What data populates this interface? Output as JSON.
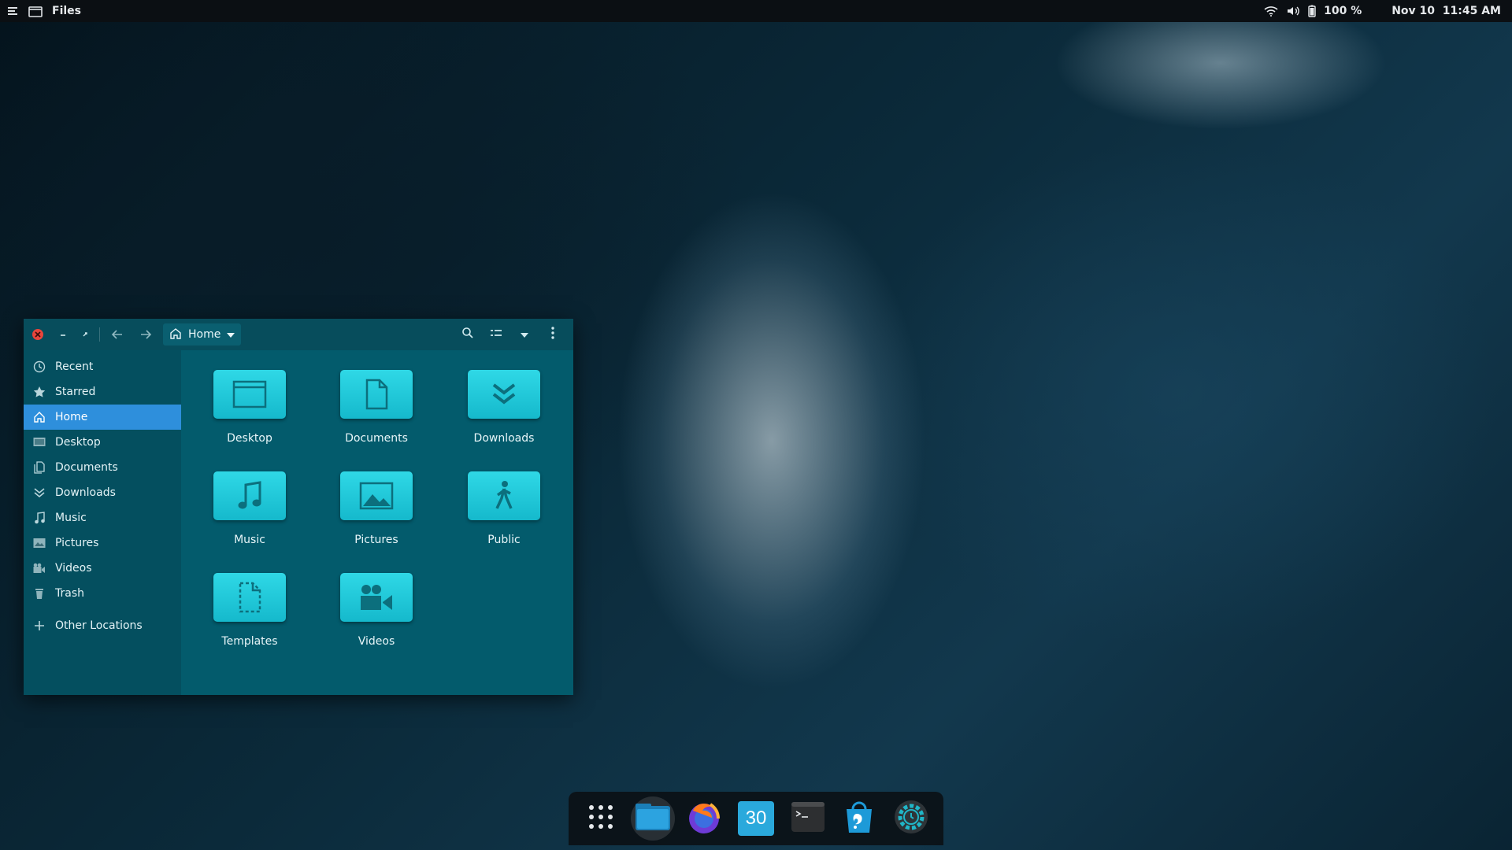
{
  "topbar": {
    "app_name": "Files",
    "battery": "100 %",
    "datetime": "Nov 10  11:45 AM"
  },
  "window": {
    "location": "Home"
  },
  "sidebar": {
    "items": [
      {
        "label": "Recent",
        "icon": "clock-icon"
      },
      {
        "label": "Starred",
        "icon": "star-icon"
      },
      {
        "label": "Home",
        "icon": "home-icon",
        "active": true
      },
      {
        "label": "Desktop",
        "icon": "desktop-icon"
      },
      {
        "label": "Documents",
        "icon": "document-icon"
      },
      {
        "label": "Downloads",
        "icon": "download-icon"
      },
      {
        "label": "Music",
        "icon": "music-icon"
      },
      {
        "label": "Pictures",
        "icon": "picture-icon"
      },
      {
        "label": "Videos",
        "icon": "video-icon"
      },
      {
        "label": "Trash",
        "icon": "trash-icon"
      }
    ],
    "other_locations": "Other Locations"
  },
  "folders": [
    {
      "label": "Desktop",
      "icon": "desktop-folder-icon"
    },
    {
      "label": "Documents",
      "icon": "documents-folder-icon"
    },
    {
      "label": "Downloads",
      "icon": "downloads-folder-icon"
    },
    {
      "label": "Music",
      "icon": "music-folder-icon"
    },
    {
      "label": "Pictures",
      "icon": "pictures-folder-icon"
    },
    {
      "label": "Public",
      "icon": "public-folder-icon"
    },
    {
      "label": "Templates",
      "icon": "templates-folder-icon"
    },
    {
      "label": "Videos",
      "icon": "videos-folder-icon"
    }
  ],
  "dock": {
    "calendar_day": "30",
    "apps": [
      "app-grid-icon",
      "files-icon",
      "firefox-icon",
      "calendar-icon",
      "terminal-icon",
      "software-icon",
      "settings-icon"
    ]
  },
  "colors": {
    "accent": "#2e8fdc",
    "folder": "#1fc6d8",
    "window_bg": "#025a6b",
    "sidebar_bg": "#044f5f",
    "close_button": "#e8453c"
  }
}
